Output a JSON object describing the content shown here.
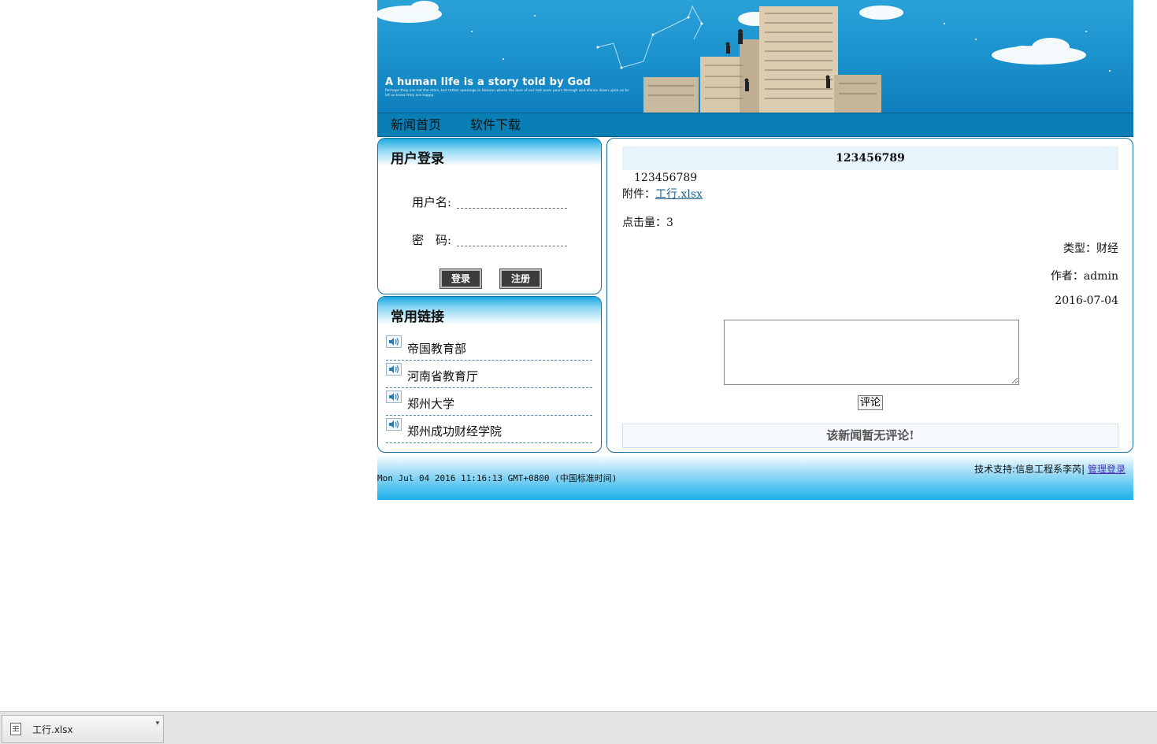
{
  "banner": {
    "title": "A human life is a story told by God",
    "subtitle": "Perhaps they are not the stars, but rather openings in Heaven where the love of our lost ones pours through and shines down upon us to let us know they are happy."
  },
  "nav": {
    "items": [
      {
        "label": "新闻首页"
      },
      {
        "label": "软件下载"
      }
    ]
  },
  "login": {
    "title": "用户登录",
    "username_label": "用户名:",
    "password_label": "密　码:",
    "login_button": "登录",
    "register_button": "注册"
  },
  "links": {
    "title": "常用链接",
    "items": [
      {
        "label": "帝国教育部"
      },
      {
        "label": "河南省教育厅"
      },
      {
        "label": "郑州大学"
      },
      {
        "label": "郑州成功财经学院"
      }
    ]
  },
  "article": {
    "title": "123456789",
    "body": "123456789",
    "attachment_label": "附件：",
    "attachment_name": "工行.xlsx",
    "clicks": "点击量：3",
    "type": "类型：财经",
    "author": "作者：admin",
    "date": "2016-07-04",
    "comment_button": "评论",
    "no_comment": "该新闻暂无评论!"
  },
  "footer": {
    "clock": "Mon Jul 04 2016 11:16:13 GMT+0800 (中国标准时间)",
    "support": "技术支持:信息工程系李芮|",
    "admin_link": "管理登录"
  },
  "download_bar": {
    "file_name": "工行.xlsx"
  },
  "colors": {
    "banner_sky": "#1a90cc",
    "nav_bg": "#0a7fb6",
    "panel_border": "#1670a0",
    "link_color": "#1a5f8a"
  }
}
